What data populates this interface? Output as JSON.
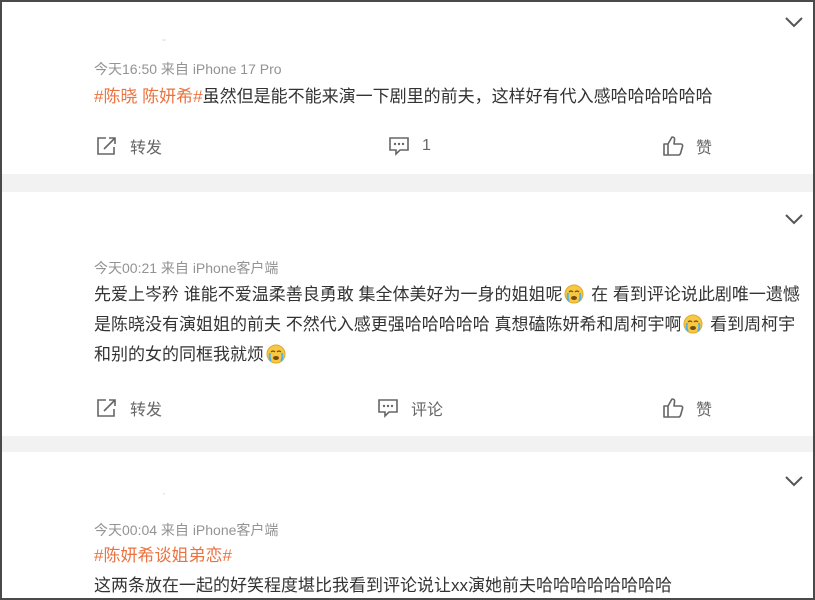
{
  "posts": [
    {
      "meta": "今天16:50  来自 iPhone 17 Pro",
      "tag": "#陈晓 陈妍希#",
      "text": "虽然但是能不能来演一下剧里的前夫，这样好有代入感哈哈哈哈哈哈",
      "repost_label": "转发",
      "comment_label": "1",
      "like_label": "赞"
    },
    {
      "meta": "今天00:21  来自 iPhone客户端",
      "text_part1": "先爱上岑矜 谁能不爱温柔善良勇敢 集全体美好为一身的姐姐呢",
      "text_part2": " 在        看到评论说此剧唯一遗憾是陈晓没有演姐姐的前夫 不然代入感更强哈哈哈哈哈 真想磕陈妍希和周柯宇啊",
      "text_part3": " 看到周柯宇和别的女的同框我就烦",
      "repost_label": "转发",
      "comment_label": "评论",
      "like_label": "赞"
    },
    {
      "meta": "今天00:04  来自 iPhone客户端",
      "tag": "#陈妍希谈姐弟恋#",
      "text": "这两条放在一起的好笑程度堪比我看到评论说让xx演她前夫哈哈哈哈哈哈哈哈"
    }
  ],
  "icons": {
    "expand": "chevron-down-icon",
    "repost": "repost-icon",
    "comment": "comment-icon",
    "like": "thumbs-up-icon",
    "emoji": "crying-face-emoji"
  },
  "colors": {
    "tag": "#eb7340",
    "meta": "#939393",
    "separator": "#f2f2f2"
  }
}
